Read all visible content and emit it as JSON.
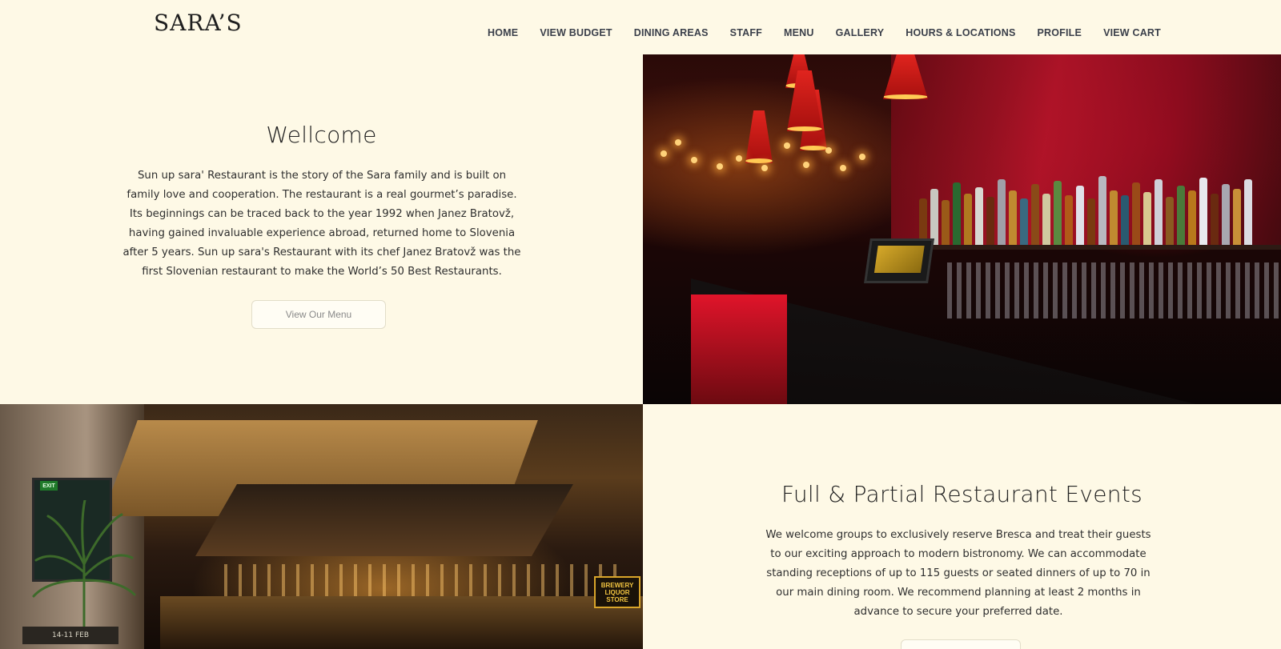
{
  "header": {
    "logo": "SARA’S",
    "nav": [
      {
        "label": "HOME"
      },
      {
        "label": "VIEW BUDGET"
      },
      {
        "label": "DINING AREAS"
      },
      {
        "label": "STAFF"
      },
      {
        "label": "MENU"
      },
      {
        "label": "GALLERY"
      },
      {
        "label": "HOURS & LOCATIONS"
      },
      {
        "label": "PROFILE"
      },
      {
        "label": "VIEW CART"
      }
    ]
  },
  "welcome": {
    "title": "Wellcome",
    "body": "Sun up sara' Restaurant is the story of the Sara family and is built on family love and cooperation. The restaurant is a real gourmet’s paradise. Its beginnings can be traced back to the year 1992 when Janez Bratovž, having gained invaluable experience abroad, returned home to Slovenia after 5 years. Sun up sara's Restaurant with its chef Janez Bratovž was the first Slovenian restaurant to make the World’s 50 Best Restaurants.",
    "button": "View Our Menu"
  },
  "events": {
    "title": "Full & Partial Restaurant Events",
    "body": "We welcome groups to exclusively reserve Bresca and treat their guests to our exciting approach to modern bistronomy. We can accommodate standing receptions of up to 115 guests or seated dinners of up to 70 in our main dining room. We recommend planning at least 2 months in advance to secure your preferred date."
  },
  "photos": {
    "interior_sign": "BREWERY LIQUOR STORE",
    "interior_chalk": "14-11 FEB",
    "interior_exit": "EXIT"
  },
  "colors": {
    "page_bg": "#fef9e6",
    "nav_text": "#3a3f4a",
    "accent_red": "#c8102e"
  }
}
